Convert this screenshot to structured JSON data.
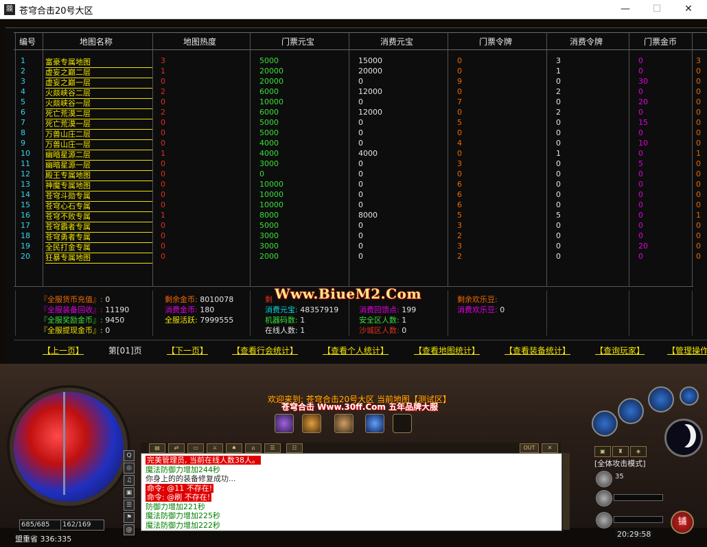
{
  "window": {
    "title": "苍穹合击20号大区",
    "icon_glyph": "龖",
    "minimize": "—",
    "maximize": "☐",
    "close": "✕"
  },
  "table": {
    "headers": [
      "编号",
      "地图名称",
      "地图热度",
      "门票元宝",
      "消费元宝",
      "门票令牌",
      "消费令牌",
      "门票金币"
    ],
    "rows": [
      {
        "id": "1",
        "name": "富豪专属地图",
        "heat": "3",
        "ticket_yb": "5000",
        "spend_yb": "15000",
        "ticket_lp": "0",
        "spend_lp": "3",
        "ticket_gold": "0",
        "extra": "3"
      },
      {
        "id": "2",
        "name": "虚妄之巅二层",
        "heat": "1",
        "ticket_yb": "20000",
        "spend_yb": "20000",
        "ticket_lp": "0",
        "spend_lp": "1",
        "ticket_gold": "0",
        "extra": "0"
      },
      {
        "id": "3",
        "name": "虚妄之巅一层",
        "heat": "0",
        "ticket_yb": "20000",
        "spend_yb": "0",
        "ticket_lp": "9",
        "spend_lp": "0",
        "ticket_gold": "30",
        "extra": "0"
      },
      {
        "id": "4",
        "name": "火燚峡谷二层",
        "heat": "2",
        "ticket_yb": "6000",
        "spend_yb": "12000",
        "ticket_lp": "0",
        "spend_lp": "2",
        "ticket_gold": "0",
        "extra": "0"
      },
      {
        "id": "5",
        "name": "火燚峡谷一层",
        "heat": "0",
        "ticket_yb": "10000",
        "spend_yb": "0",
        "ticket_lp": "7",
        "spend_lp": "0",
        "ticket_gold": "20",
        "extra": "0"
      },
      {
        "id": "6",
        "name": "死亡荒漠二层",
        "heat": "2",
        "ticket_yb": "6000",
        "spend_yb": "12000",
        "ticket_lp": "0",
        "spend_lp": "2",
        "ticket_gold": "0",
        "extra": "0"
      },
      {
        "id": "7",
        "name": "死亡荒漠一层",
        "heat": "0",
        "ticket_yb": "5000",
        "spend_yb": "0",
        "ticket_lp": "5",
        "spend_lp": "0",
        "ticket_gold": "15",
        "extra": "0"
      },
      {
        "id": "8",
        "name": "万兽山庄二层",
        "heat": "0",
        "ticket_yb": "5000",
        "spend_yb": "0",
        "ticket_lp": "0",
        "spend_lp": "0",
        "ticket_gold": "0",
        "extra": "0"
      },
      {
        "id": "9",
        "name": "万兽山庄一层",
        "heat": "0",
        "ticket_yb": "4000",
        "spend_yb": "0",
        "ticket_lp": "4",
        "spend_lp": "0",
        "ticket_gold": "10",
        "extra": "0"
      },
      {
        "id": "10",
        "name": "幽暗星源二层",
        "heat": "1",
        "ticket_yb": "4000",
        "spend_yb": "4000",
        "ticket_lp": "0",
        "spend_lp": "1",
        "ticket_gold": "0",
        "extra": "1"
      },
      {
        "id": "11",
        "name": "幽暗星源一层",
        "heat": "0",
        "ticket_yb": "3000",
        "spend_yb": "0",
        "ticket_lp": "3",
        "spend_lp": "0",
        "ticket_gold": "5",
        "extra": "0"
      },
      {
        "id": "12",
        "name": "殿王专属地图",
        "heat": "0",
        "ticket_yb": "0",
        "spend_yb": "0",
        "ticket_lp": "0",
        "spend_lp": "0",
        "ticket_gold": "0",
        "extra": "0"
      },
      {
        "id": "13",
        "name": "神魔专属地图",
        "heat": "0",
        "ticket_yb": "10000",
        "spend_yb": "0",
        "ticket_lp": "6",
        "spend_lp": "0",
        "ticket_gold": "0",
        "extra": "0"
      },
      {
        "id": "14",
        "name": "苍穹斗勋专属",
        "heat": "0",
        "ticket_yb": "10000",
        "spend_yb": "0",
        "ticket_lp": "6",
        "spend_lp": "0",
        "ticket_gold": "0",
        "extra": "0"
      },
      {
        "id": "15",
        "name": "苍穹心石专属",
        "heat": "0",
        "ticket_yb": "10000",
        "spend_yb": "0",
        "ticket_lp": "6",
        "spend_lp": "0",
        "ticket_gold": "0",
        "extra": "0"
      },
      {
        "id": "16",
        "name": "苍穹不败专属",
        "heat": "1",
        "ticket_yb": "8000",
        "spend_yb": "8000",
        "ticket_lp": "5",
        "spend_lp": "5",
        "ticket_gold": "0",
        "extra": "1"
      },
      {
        "id": "17",
        "name": "苍穹霸者专属",
        "heat": "0",
        "ticket_yb": "5000",
        "spend_yb": "0",
        "ticket_lp": "3",
        "spend_lp": "0",
        "ticket_gold": "0",
        "extra": "0"
      },
      {
        "id": "18",
        "name": "苍穹勇者专属",
        "heat": "0",
        "ticket_yb": "3000",
        "spend_yb": "0",
        "ticket_lp": "2",
        "spend_lp": "0",
        "ticket_gold": "0",
        "extra": "0"
      },
      {
        "id": "19",
        "name": "全民打金专属",
        "heat": "0",
        "ticket_yb": "3000",
        "spend_yb": "0",
        "ticket_lp": "3",
        "spend_lp": "0",
        "ticket_gold": "20",
        "extra": "0"
      },
      {
        "id": "20",
        "name": "狂暴专属地图",
        "heat": "0",
        "ticket_yb": "2000",
        "spend_yb": "0",
        "ticket_lp": "2",
        "spend_lp": "0",
        "ticket_gold": "0",
        "extra": "0"
      }
    ]
  },
  "stats": {
    "col1": [
      {
        "label": "『全服货币充值』:",
        "value": "0",
        "color": "#f06a00"
      },
      {
        "label": "『全服装备回收』:",
        "value": "11190",
        "color": "#e000e0"
      },
      {
        "label": "『全服奖励金币』:",
        "value": "9450",
        "color": "#38e038"
      },
      {
        "label": "『全服提现金币』:",
        "value": "0",
        "color": "#f2e400"
      }
    ],
    "col2": [
      {
        "label": "剩余金币:",
        "value": "8010078",
        "color": "#f06a00"
      },
      {
        "label": "消费金币:",
        "value": "180",
        "color": "#e000e0"
      },
      {
        "label": "全服活跃:",
        "value": "7999555",
        "color": "#f2e400"
      }
    ],
    "col3": [
      {
        "label": "剩",
        "value": "",
        "color": "#e03020"
      },
      {
        "label": "消费元宝:",
        "value": "48357919",
        "color": "#00d8e0"
      },
      {
        "label": "机器码数:",
        "value": "1",
        "color": "#38e038"
      },
      {
        "label": "在线人数:",
        "value": "1",
        "color": "#e6e6e6"
      }
    ],
    "col4": [
      {
        "label": "消费回馈点:",
        "value": "199",
        "color": "#e000e0"
      },
      {
        "label": "安全区人数:",
        "value": "1",
        "color": "#38e038"
      },
      {
        "label": "沙城区人数:",
        "value": "0",
        "color": "#e03020"
      }
    ],
    "col5": [
      {
        "label": "剩余欢乐豆:",
        "value": "",
        "color": "#f06a00"
      },
      {
        "label": "消费欢乐豆:",
        "value": "0",
        "color": "#e000e0"
      }
    ]
  },
  "nav": {
    "prev": "上一页",
    "page": "第[01]页",
    "next": "下一页",
    "guild_stats": "查看行会统计",
    "personal_stats": "查看个人统计",
    "map_stats": "查看地图统计",
    "equip_stats": "查看装备统计",
    "query_player": "查询玩家",
    "admin_ops": "管理操作"
  },
  "watermark": "Www.BiueM2.Com",
  "announce": {
    "line1": "欢迎来到: 苍穹合击20号大区  当前地图【测试区】",
    "line2": "苍穹合击  Www.30ff.Com  五年品牌大服"
  },
  "chat": {
    "lines": [
      {
        "text": "完美管理员, 当前在线人数38人。",
        "style": "red"
      },
      {
        "text": "魔法防御力增加244秒",
        "style": "green"
      },
      {
        "text": "你身上的的装备修复成功...",
        "style": "gray"
      },
      {
        "text": "命令: @11 不存在!",
        "style": "red"
      },
      {
        "text": "命令: @刷 不存在!",
        "style": "red"
      },
      {
        "text": "防御力增加221秒",
        "style": "green"
      },
      {
        "text": "魔法防御力增加225秒",
        "style": "green"
      },
      {
        "text": "魔法防御力增加222秒",
        "style": "green"
      }
    ],
    "out": "OUT",
    "close": "✕"
  },
  "player": {
    "hp": "685/685",
    "mp": "162/169",
    "location": "盟重省 336:335"
  },
  "right": {
    "mode": "[全体攻击模式]",
    "level_label": "35",
    "clock": "20:29:58",
    "shop": "铺"
  },
  "colors": {
    "name": "#f2e400",
    "id": "#38d6f0",
    "heat": "#e03020",
    "ticket_yb": "#38e038",
    "spend_yb": "#e6e6e6",
    "ticket_lp": "#f06a00",
    "spend_lp": "#e6e6e6",
    "ticket_gold": "#e000e0",
    "extra": "#f06a00"
  }
}
